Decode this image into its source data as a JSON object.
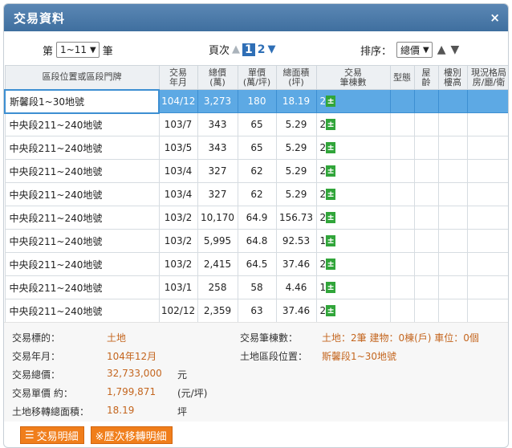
{
  "window": {
    "title": "交易資料",
    "close_icon": "×"
  },
  "toolbar": {
    "range_prefix": "第",
    "range_value": "1~11",
    "range_suffix": "筆",
    "page_label": "頁次",
    "page_current": "1",
    "page_other": "2",
    "sort_label": "排序：",
    "sort_value": "總價"
  },
  "table": {
    "headers": [
      "區段位置或區段門牌",
      "交易\n年月",
      "總價\n(萬)",
      "單價\n(萬/坪)",
      "總面積\n(坪)",
      "交易\n筆棟數",
      "型態",
      "屋\n齡",
      "樓別\n樓高",
      "現況格局\n房/廳/衛"
    ],
    "rows": [
      {
        "addr": "斯馨段1~30地號",
        "date": "104/12",
        "total": "3,273",
        "unit": "180",
        "area": "18.19",
        "count": "2"
      },
      {
        "addr": "中央段211~240地號",
        "date": "103/7",
        "total": "343",
        "unit": "65",
        "area": "5.29",
        "count": "2"
      },
      {
        "addr": "中央段211~240地號",
        "date": "103/5",
        "total": "343",
        "unit": "65",
        "area": "5.29",
        "count": "2"
      },
      {
        "addr": "中央段211~240地號",
        "date": "103/4",
        "total": "327",
        "unit": "62",
        "area": "5.29",
        "count": "2"
      },
      {
        "addr": "中央段211~240地號",
        "date": "103/4",
        "total": "327",
        "unit": "62",
        "area": "5.29",
        "count": "2"
      },
      {
        "addr": "中央段211~240地號",
        "date": "103/2",
        "total": "10,170",
        "unit": "64.9",
        "area": "156.73",
        "count": "2"
      },
      {
        "addr": "中央段211~240地號",
        "date": "103/2",
        "total": "5,995",
        "unit": "64.8",
        "area": "92.53",
        "count": "1"
      },
      {
        "addr": "中央段211~240地號",
        "date": "103/2",
        "total": "2,415",
        "unit": "64.5",
        "area": "37.46",
        "count": "2"
      },
      {
        "addr": "中央段211~240地號",
        "date": "103/1",
        "total": "258",
        "unit": "58",
        "area": "4.46",
        "count": "1"
      },
      {
        "addr": "中央段211~240地號",
        "date": "102/12",
        "total": "2,359",
        "unit": "63",
        "area": "37.46",
        "count": "2"
      }
    ],
    "plus_glyph": "±"
  },
  "details": {
    "target_label": "交易標的：",
    "target_value": "土地",
    "date_label": "交易年月：",
    "date_value": "104年12月",
    "total_label": "交易總價：",
    "total_value": "32,733,000",
    "total_unit": "元",
    "unitprice_label": "交易單價 約：",
    "unitprice_value": "1,799,871",
    "unitprice_unit": "(元/坪)",
    "area_label": "土地移轉總面積：",
    "area_value": "18.19",
    "area_unit": "坪",
    "count_label": "交易筆棟數：",
    "count_value": "土地：2筆 建物：0棟(戶) 車位：0個",
    "location_label": "土地區段位置：",
    "location_value": "斯馨段1~30地號"
  },
  "buttons": {
    "detail": "交易明細",
    "history": "※歷次移轉明細"
  },
  "colors": {
    "titlebar": "#4a7aa8",
    "selected_row": "#5da9e4",
    "value_orange": "#c4661f",
    "button_orange": "#f07e1b",
    "plus_green": "#31a53a"
  }
}
